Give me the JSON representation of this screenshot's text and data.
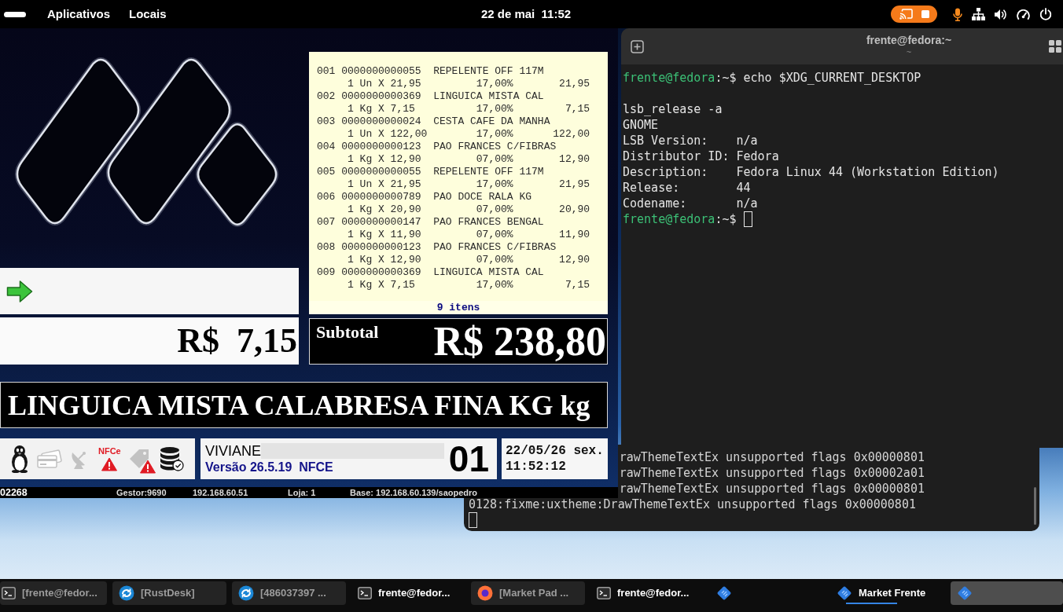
{
  "top_bar": {
    "menus": [
      "Aplicativos",
      "Locais"
    ],
    "clock": "22 de mai  11:52",
    "screen_sharing": true,
    "microphone_in_use": true
  },
  "pos_window": {
    "receipt": {
      "items": [
        {
          "seq": "001",
          "code": "0000000000055",
          "description": "REPELENTE OFF 117M",
          "quantity": "1 Un X 21,95",
          "tax": "17,00%",
          "total": "21,95"
        },
        {
          "seq": "002",
          "code": "0000000000369",
          "description": "LINGUICA MISTA CAL",
          "quantity": "1 Kg X 7,15",
          "tax": "17,00%",
          "total": "7,15"
        },
        {
          "seq": "003",
          "code": "0000000000024",
          "description": "CESTA CAFE DA MANHA",
          "quantity": "1 Un X 122,00",
          "tax": "17,00%",
          "total": "122,00"
        },
        {
          "seq": "004",
          "code": "0000000000123",
          "description": "PAO FRANCES C/FIBRAS",
          "quantity": "1 Kg X 12,90",
          "tax": "07,00%",
          "total": "12,90"
        },
        {
          "seq": "005",
          "code": "0000000000055",
          "description": "REPELENTE OFF 117M",
          "quantity": "1 Un X 21,95",
          "tax": "17,00%",
          "total": "21,95"
        },
        {
          "seq": "006",
          "code": "0000000000789",
          "description": "PAO DOCE RALA KG",
          "quantity": "1 Kg X 20,90",
          "tax": "07,00%",
          "total": "20,90"
        },
        {
          "seq": "007",
          "code": "0000000000147",
          "description": "PAO FRANCES BENGAL",
          "quantity": "1 Kg X 11,90",
          "tax": "07,00%",
          "total": "11,90"
        },
        {
          "seq": "008",
          "code": "0000000000123",
          "description": "PAO FRANCES C/FIBRAS",
          "quantity": "1 Kg X 12,90",
          "tax": "07,00%",
          "total": "12,90"
        },
        {
          "seq": "009",
          "code": "0000000000369",
          "description": "LINGUICA MISTA CAL",
          "quantity": "1 Kg X 7,15",
          "tax": "17,00%",
          "total": "7,15"
        }
      ],
      "count": "9 itens"
    },
    "unit_price": "R$  7,15",
    "subtotal": {
      "label": "Subtotal",
      "value": "R$ 238,80"
    },
    "product_name": "LINGUICA MISTA CALABRESA FINA KG kg",
    "status_icons": [
      {
        "kind": "penguin",
        "enabled": true,
        "warning": false
      },
      {
        "kind": "cards",
        "enabled": false,
        "warning": false
      },
      {
        "kind": "dish",
        "enabled": false,
        "warning": false
      },
      {
        "kind": "nfce",
        "label": "NFCe",
        "enabled": true,
        "warning": true
      },
      {
        "kind": "tag",
        "enabled": false,
        "warning": true
      },
      {
        "kind": "database",
        "enabled": true,
        "warning": false
      }
    ],
    "operator": {
      "name": "VIVIANE",
      "version": "Versão 26.5.19  NFCE",
      "register": "01"
    },
    "clock": {
      "date": "22/05/26 sex.",
      "time": "11:52:12"
    },
    "status_line": [
      "02268",
      "Gestor:9690",
      "192.168.60.51",
      "Loja: 1",
      "Base: 192.168.60.139/saopedro"
    ]
  },
  "terminal_window": {
    "title": "frente@fedora:~",
    "subtitle": "~",
    "lines": [
      {
        "kind": "prompt",
        "user": "frente@fedora",
        "prompt": ":~$",
        "command": "echo $XDG_CURRENT_DESKTOP",
        "cursor": false
      },
      {
        "kind": "blank"
      },
      {
        "kind": "output",
        "text": "lsb_release -a"
      },
      {
        "kind": "output",
        "text": "GNOME"
      },
      {
        "kind": "output",
        "text": "LSB Version:    n/a"
      },
      {
        "kind": "output",
        "text": "Distributor ID: Fedora"
      },
      {
        "kind": "output",
        "text": "Description:    Fedora Linux 44 (Workstation Edition)"
      },
      {
        "kind": "output",
        "text": "Release:        44"
      },
      {
        "kind": "output",
        "text": "Codename:       n/a"
      },
      {
        "kind": "prompt",
        "user": "frente@fedora",
        "prompt": ":~$",
        "cursor": true
      }
    ]
  },
  "background_terminal": {
    "lines": [
      {
        "kind": "covered",
        "text": "rawThemeTextEx unsupported flags 0x00000801"
      },
      {
        "kind": "covered",
        "text": "rawThemeTextEx unsupported flags 0x00002a01"
      },
      {
        "kind": "covered",
        "text": "rawThemeTextEx unsupported flags 0x00000801"
      },
      {
        "kind": "full",
        "text": "0128:fixme:uxtheme:DrawThemeTextEx unsupported flags 0x00000801"
      }
    ],
    "cursor": true
  },
  "taskbar": {
    "left_items": [
      {
        "kind": "terminal",
        "label": "[frente@fedor...",
        "minimized": true,
        "selected": false,
        "hovered": false
      },
      {
        "kind": "remote-desktop",
        "label": "[RustDesk]",
        "minimized": true,
        "selected": false,
        "hovered": false
      },
      {
        "kind": "remote-desktop",
        "label": "[486037397 ...",
        "minimized": true,
        "selected": false,
        "hovered": false
      },
      {
        "kind": "terminal",
        "label": "frente@fedor...",
        "minimized": false,
        "selected": false,
        "hovered": false
      },
      {
        "kind": "browser",
        "label": "[Market Pad ...",
        "minimized": true,
        "selected": false,
        "hovered": false
      },
      {
        "kind": "terminal",
        "label": "frente@fedor...",
        "minimized": false,
        "selected": false,
        "hovered": false
      },
      {
        "kind": "diamond",
        "minimized": false,
        "selected": false,
        "hovered": false
      }
    ],
    "right_items": [
      {
        "kind": "diamond",
        "label": "Market Frente",
        "minimized": false,
        "selected": true,
        "hovered": false
      },
      {
        "kind": "diamond",
        "minimized": false,
        "selected": false,
        "hovered": true
      }
    ]
  }
}
